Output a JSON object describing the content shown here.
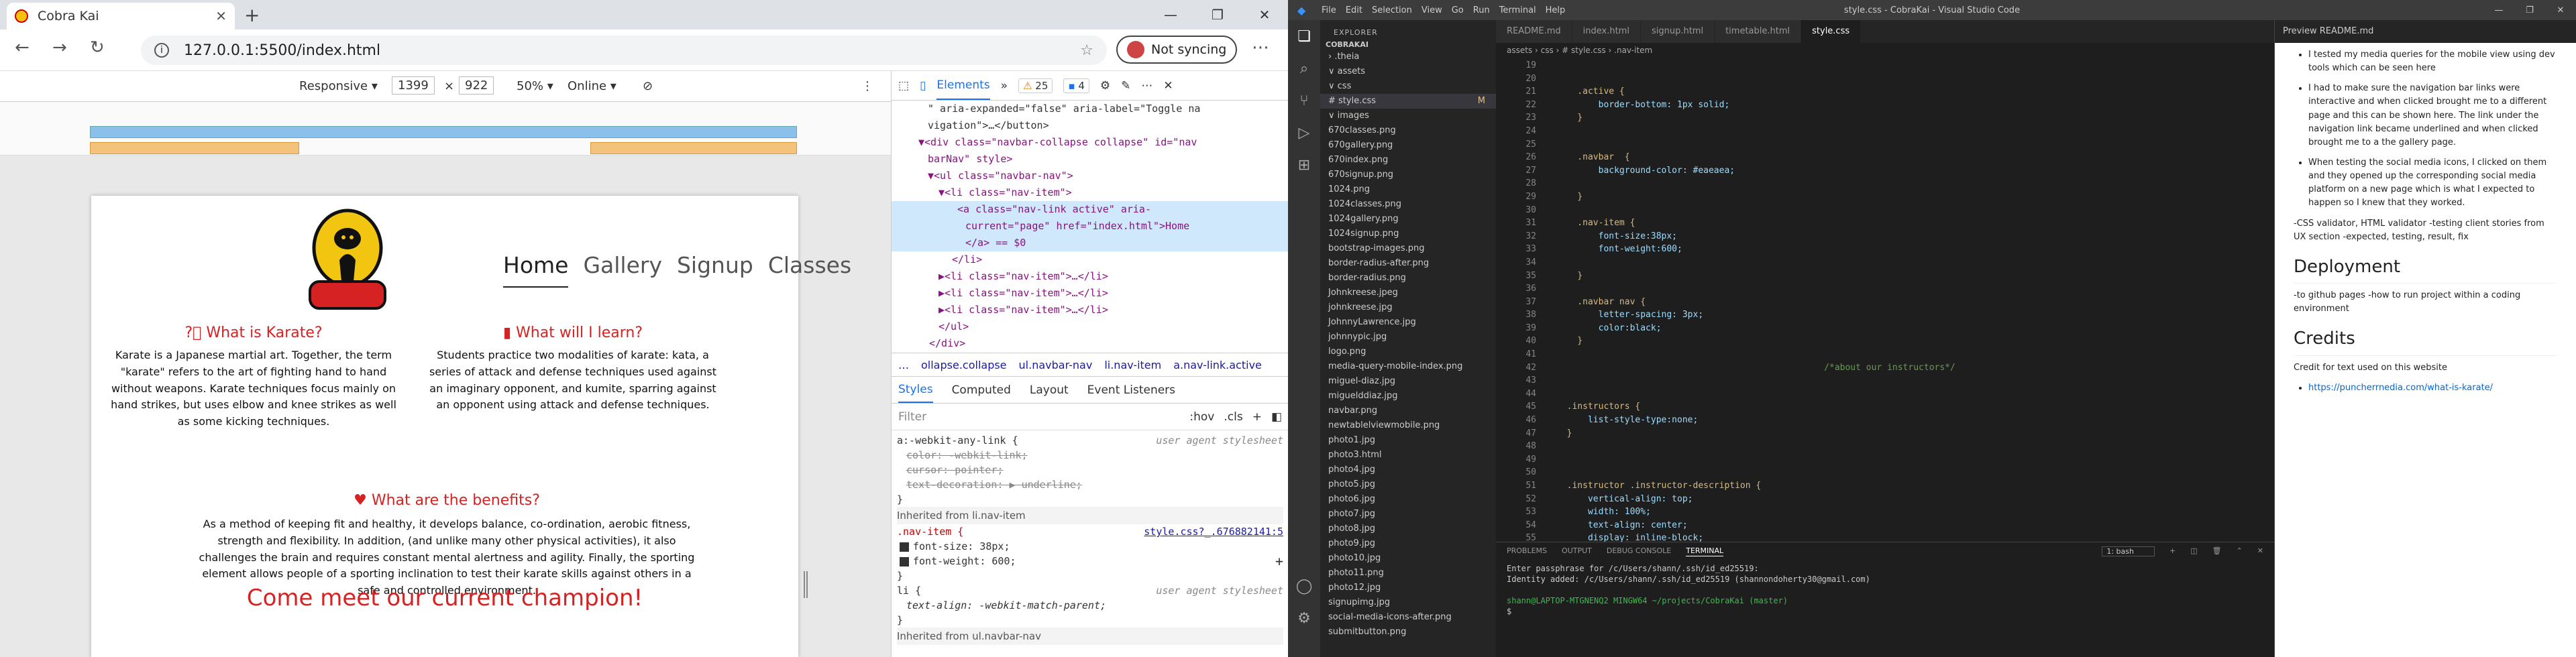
{
  "browser": {
    "tab_title": "Cobra Kai",
    "new_tab": "+",
    "address": "127.0.0.1:5500/index.html",
    "sync_label": "Not syncing",
    "device_toolbar": {
      "mode": "Responsive ▾",
      "width": "1399",
      "height": "922",
      "zoom": "50% ▾",
      "network": "Online ▾"
    },
    "page": {
      "nav": [
        "Home",
        "Gallery",
        "Signup",
        "Classes"
      ],
      "karate_heading": "What is Karate?",
      "karate_text": "Karate is a Japanese martial art. Together, the term \"karate\" refers to the art of fighting hand to hand without weapons. Karate techniques focus mainly on hand strikes, but uses elbow and knee strikes as well as some kicking techniques.",
      "learn_heading": "What will I learn?",
      "learn_text": "Students practice two modalities of karate: kata, a series of attack and defense techniques used against an imaginary opponent, and kumite, sparring against an opponent using attack and defense techniques.",
      "benefits_heading": "What are the benefits?",
      "benefits_text": "As a method of keeping fit and healthy, it develops balance, co-ordination, aerobic fitness, strength and flexibility. In addition, (and unlike many other physical activities), it also challenges the brain and requires constant mental alertness and agility. Finally, the sporting element allows people of a sporting inclination to test their karate skills against others in a safe and controlled environment.",
      "champion_heading": "Come meet our current champion!"
    },
    "devtools": {
      "tab_elements": "Elements",
      "warnings": "25",
      "errors": "4",
      "dom_lines": [
        "\" aria-expanded=\"false\" aria-label=\"Toggle na",
        "vigation\">…</button>",
        "▼<div class=\"navbar-collapse collapse\" id=\"nav",
        "barNav\" style>",
        "▼<ul class=\"navbar-nav\">",
        "▼<li class=\"nav-item\">",
        "<a class=\"nav-link active\" aria-",
        "current=\"page\" href=\"index.html\">Home",
        "</a> == $0",
        "</li>",
        "▶<li class=\"nav-item\">…</li>",
        "▶<li class=\"nav-item\">…</li>",
        "▶<li class=\"nav-item\">…</li>",
        "</ul>",
        "</div>"
      ],
      "breadcrumb": [
        "…",
        "ollapse.collapse",
        "ul.navbar-nav",
        "li.nav-item",
        "a.nav-link.active"
      ],
      "style_tabs": [
        "Styles",
        "Computed",
        "Layout",
        "Event Listeners"
      ],
      "filter_placeholder": "Filter",
      "filter_tools": [
        ":hov",
        ".cls",
        "+"
      ],
      "ua_label": "user agent stylesheet",
      "ua_selector": "a:-webkit-any-link {",
      "ua_props": [
        "color: -webkit-link;",
        "cursor: pointer;",
        "text-decoration: ▶ underline;"
      ],
      "inherited1": "Inherited from li.nav-item",
      "rule_selector": ".nav-item {",
      "rule_source": "style.css?_.676882141:5",
      "rule_props": [
        "font-size: 38px;",
        "font-weight: 600;"
      ],
      "li_selector": "li {",
      "li_props": [
        "text-align: -webkit-match-parent;"
      ],
      "inherited2": "Inherited from ul.navbar-nav"
    }
  },
  "vscode": {
    "title": "style.css - CobraKai - Visual Studio Code",
    "menu": [
      "File",
      "Edit",
      "Selection",
      "View",
      "Go",
      "Run",
      "Terminal",
      "Help"
    ],
    "explorer_label": "EXPLORER",
    "project": "COBRAKAI",
    "tree": [
      "› .theia",
      "∨ assets",
      "  ∨ css",
      "    # style.css",
      "  ∨ images",
      "    670classes.png",
      "    670gallery.png",
      "    670index.png",
      "    670signup.png",
      "    1024.png",
      "    1024classes.png",
      "    1024gallery.png",
      "    1024signup.png",
      "    bootstrap-images.png",
      "    border-radius-after.png",
      "    border-radius.png",
      "    Johnkreese.jpeg",
      "    johnkreese.jpg",
      "    JohnnyLawrence.jpg",
      "    johnnypic.jpg",
      "    logo.png",
      "    media-query-mobile-index.png",
      "    miguel-diaz.jpg",
      "    miguelddiaz.jpg",
      "    navbar.png",
      "    newtablelviewmobile.png",
      "    photo1.jpg",
      "    photo3.html",
      "    photo4.jpg",
      "    photo5.jpg",
      "    photo6.jpg",
      "    photo7.jpg",
      "    photo8.jpg",
      "    photo9.jpg",
      "    photo10.jpg",
      "    photo11.png",
      "    photo12.jpg",
      "    signupimg.jpg",
      "    social-media-icons-after.png",
      "    submitbutton.png"
    ],
    "tree_active": 3,
    "tree_modified": "M",
    "editor_tabs": [
      "README.md",
      "index.html",
      "signup.html",
      "timetable.html",
      "style.css"
    ],
    "editor_breadcrumb": "assets › css › # style.css › .nav-item",
    "code": [
      {
        "n": "19",
        "t": ""
      },
      {
        "n": "20",
        "t": ""
      },
      {
        "n": "21",
        "t": "    .active {"
      },
      {
        "n": "22",
        "t": "        border-bottom: 1px solid;"
      },
      {
        "n": "23",
        "t": "    }"
      },
      {
        "n": "24",
        "t": ""
      },
      {
        "n": "25",
        "t": ""
      },
      {
        "n": "26",
        "t": "    .navbar  {"
      },
      {
        "n": "27",
        "t": "        background-color: #eaeaea;"
      },
      {
        "n": "28",
        "t": ""
      },
      {
        "n": "29",
        "t": "    }"
      },
      {
        "n": "30",
        "t": ""
      },
      {
        "n": "31",
        "t": "    .nav-item {"
      },
      {
        "n": "32",
        "t": "        font-size:38px;"
      },
      {
        "n": "33",
        "t": "        font-weight:600;"
      },
      {
        "n": "34",
        "t": ""
      },
      {
        "n": "35",
        "t": "    }"
      },
      {
        "n": "36",
        "t": ""
      },
      {
        "n": "37",
        "t": "    .navbar nav {"
      },
      {
        "n": "38",
        "t": "        letter-spacing: 3px;"
      },
      {
        "n": "39",
        "t": "        color:black;"
      },
      {
        "n": "40",
        "t": "    }"
      },
      {
        "n": "41",
        "t": ""
      },
      {
        "n": "42",
        "t": "                                                   /*about our instructors*/"
      },
      {
        "n": "43",
        "t": ""
      },
      {
        "n": "44",
        "t": ""
      },
      {
        "n": "45",
        "t": "  .instructors {"
      },
      {
        "n": "46",
        "t": "      list-style-type:none;"
      },
      {
        "n": "47",
        "t": "  }"
      },
      {
        "n": "48",
        "t": ""
      },
      {
        "n": "49",
        "t": ""
      },
      {
        "n": "50",
        "t": ""
      },
      {
        "n": "51",
        "t": "  .instructor .instructor-description {"
      },
      {
        "n": "52",
        "t": "      vertical-align: top;"
      },
      {
        "n": "53",
        "t": "      width: 100%;"
      },
      {
        "n": "54",
        "t": "      text-align: center;"
      },
      {
        "n": "55",
        "t": "      display: inline-block;"
      }
    ],
    "panel_tabs": [
      "PROBLEMS",
      "OUTPUT",
      "DEBUG CONSOLE",
      "TERMINAL"
    ],
    "terminal_shell": "1: bash",
    "terminal": [
      "Enter passphrase for /c/Users/shann/.ssh/id_ed25519:",
      "Identity added: /c/Users/shann/.ssh/id_ed25519 (shannondoherty30@gmail.com)",
      "",
      "shann@LAPTOP-MTGNENQ2 MINGW64 ~/projects/CobraKai (master)",
      "$ "
    ],
    "preview_title": "Preview README.md",
    "preview": {
      "bullets1": [
        "I tested my media queries for the mobile view using dev tools which can be seen here",
        "I had to make sure the navigation bar links were interactive and when clicked brought me to a different page and this can be shown here. The link under the navigation link became underlined and when clicked brought me to a the gallery page.",
        "When testing the social media icons, I clicked on them and they opened up the corresponding social media platform on a new page which is what I expected to happen so I knew that they worked."
      ],
      "para1": "-CSS validator, HTML validator -testing client stories from UX section -expected, testing, result, fix",
      "h_deploy": "Deployment",
      "para2": "-to github pages -how to run project within a coding environment",
      "h_credits": "Credits",
      "para3": "Credit for text used on this website",
      "link": "https://puncherrnedia.com/what-is-karate/"
    }
  }
}
